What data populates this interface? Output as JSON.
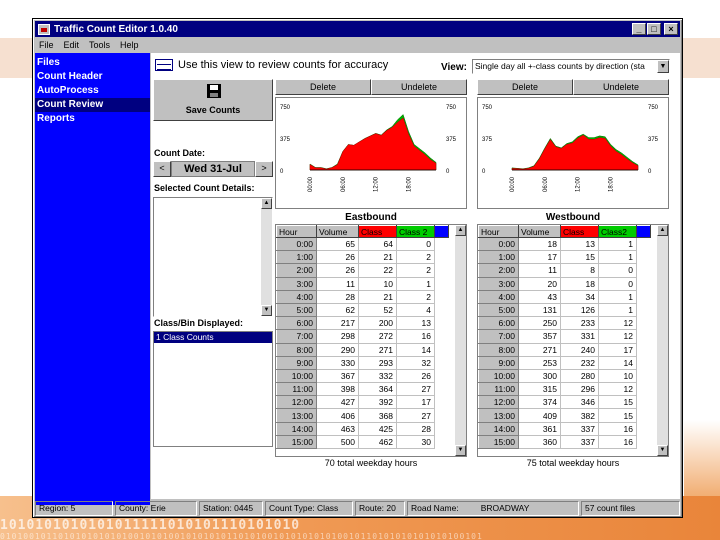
{
  "window": {
    "title": "Traffic Count Editor 1.0.40"
  },
  "menu": [
    "File",
    "Edit",
    "Tools",
    "Help"
  ],
  "nav": {
    "items": [
      "Files",
      "Count Header",
      "AutoProcess",
      "Count Review",
      "Reports"
    ],
    "active": "Count Review"
  },
  "header": {
    "instruction": "Use this view to review counts for accuracy",
    "view_label": "View:",
    "view_value": "Single day all +-class counts by direction (sta"
  },
  "left_panel": {
    "save_label": "Save Counts",
    "count_date_label": "Count Date:",
    "count_date_value": "Wed 31-Jul",
    "prev_arrow": "<",
    "next_arrow": ">",
    "details_label": "Selected Count Details:",
    "class_label": "Class/Bin Displayed:",
    "class_items": [
      "1 Class Counts"
    ]
  },
  "eastbound": {
    "delete_label": "Delete",
    "undelete_label": "Undelete",
    "title": "Eastbound",
    "columns": [
      "Hour",
      "Volume",
      "Class",
      "Class 2"
    ],
    "rows": [
      [
        "0:00",
        "65",
        "64",
        "0"
      ],
      [
        "1:00",
        "26",
        "21",
        "2"
      ],
      [
        "2:00",
        "26",
        "22",
        "2"
      ],
      [
        "3:00",
        "11",
        "10",
        "1"
      ],
      [
        "4:00",
        "28",
        "21",
        "2"
      ],
      [
        "5:00",
        "62",
        "52",
        "4"
      ],
      [
        "6:00",
        "217",
        "200",
        "13"
      ],
      [
        "7:00",
        "298",
        "272",
        "16"
      ],
      [
        "8:00",
        "290",
        "271",
        "14"
      ],
      [
        "9:00",
        "330",
        "293",
        "32"
      ],
      [
        "10:00",
        "367",
        "332",
        "26"
      ],
      [
        "11:00",
        "398",
        "364",
        "27"
      ],
      [
        "12:00",
        "427",
        "392",
        "17"
      ],
      [
        "13:00",
        "406",
        "368",
        "27"
      ],
      [
        "14:00",
        "463",
        "425",
        "28"
      ],
      [
        "15:00",
        "500",
        "462",
        "30"
      ]
    ],
    "total": "70 total weekday hours",
    "y_ticks": [
      "750",
      "375",
      "0"
    ],
    "x_ticks": [
      "00:00",
      "06:00",
      "12:00",
      "18:00"
    ]
  },
  "westbound": {
    "delete_label": "Delete",
    "undelete_label": "Undelete",
    "title": "Westbound",
    "columns": [
      "Hour",
      "Volume",
      "Class",
      "Class2"
    ],
    "rows": [
      [
        "0:00",
        "18",
        "13",
        "1"
      ],
      [
        "1:00",
        "17",
        "15",
        "1"
      ],
      [
        "2:00",
        "11",
        "8",
        "0"
      ],
      [
        "3:00",
        "20",
        "18",
        "0"
      ],
      [
        "4:00",
        "43",
        "34",
        "1"
      ],
      [
        "5:00",
        "131",
        "126",
        "1"
      ],
      [
        "6:00",
        "250",
        "233",
        "12"
      ],
      [
        "7:00",
        "357",
        "331",
        "12"
      ],
      [
        "8:00",
        "271",
        "240",
        "17"
      ],
      [
        "9:00",
        "253",
        "232",
        "14"
      ],
      [
        "10:00",
        "300",
        "280",
        "10"
      ],
      [
        "11:00",
        "315",
        "296",
        "12"
      ],
      [
        "12:00",
        "374",
        "346",
        "15"
      ],
      [
        "13:00",
        "409",
        "382",
        "15"
      ],
      [
        "14:00",
        "361",
        "337",
        "16"
      ],
      [
        "15:00",
        "360",
        "337",
        "16"
      ]
    ],
    "total": "75 total weekday hours",
    "y_ticks": [
      "750",
      "375",
      "0"
    ],
    "x_ticks": [
      "00:00",
      "06:00",
      "12:00",
      "18:00"
    ]
  },
  "chart_data": [
    {
      "type": "area",
      "title": "",
      "x": [
        0,
        1,
        2,
        3,
        4,
        5,
        6,
        7,
        8,
        9,
        10,
        11,
        12,
        13,
        14,
        15,
        16,
        17,
        18,
        19,
        20,
        21,
        22,
        23
      ],
      "series": [
        {
          "values": [
            70,
            30,
            30,
            15,
            30,
            70,
            220,
            300,
            290,
            330,
            370,
            400,
            430,
            410,
            470,
            510,
            590,
            650,
            450,
            300,
            250,
            200,
            140,
            90
          ]
        },
        {
          "values": [
            65,
            26,
            26,
            11,
            28,
            62,
            217,
            298,
            290,
            330,
            367,
            398,
            427,
            406,
            463,
            500,
            560,
            610,
            420,
            280,
            230,
            180,
            120,
            80
          ]
        }
      ],
      "ylim": [
        0,
        750
      ]
    },
    {
      "type": "area",
      "title": "",
      "x": [
        0,
        1,
        2,
        3,
        4,
        5,
        6,
        7,
        8,
        9,
        10,
        11,
        12,
        13,
        14,
        15,
        16,
        17,
        18,
        19,
        20,
        21,
        22,
        23
      ],
      "series": [
        {
          "values": [
            25,
            20,
            15,
            25,
            50,
            140,
            260,
            370,
            280,
            260,
            310,
            330,
            390,
            420,
            380,
            380,
            400,
            390,
            300,
            240,
            200,
            150,
            100,
            60
          ]
        },
        {
          "values": [
            18,
            17,
            11,
            20,
            43,
            131,
            250,
            357,
            271,
            253,
            300,
            315,
            374,
            409,
            361,
            360,
            380,
            370,
            280,
            220,
            180,
            130,
            85,
            50
          ]
        }
      ],
      "ylim": [
        0,
        750
      ]
    }
  ],
  "status": {
    "region": "Region: 5",
    "county": "County: Erie",
    "station": "Station: 0445",
    "count_type": "Count Type: Class",
    "route": "Route: 20",
    "road_name_label": "Road Name:",
    "road_name": "BROADWAY",
    "count_files": "57 count files"
  },
  "colors": {
    "nav_bg": "#0000ff",
    "class_red": "#ff0000",
    "class_green": "#00cc00",
    "class_blue": "#0000ff"
  },
  "slide": {
    "binary_top": "1010101010101011111010101110101010",
    "binary_bottom": "01010010110101010101010010101001010101011010100101010101010010110101010101010100101"
  }
}
